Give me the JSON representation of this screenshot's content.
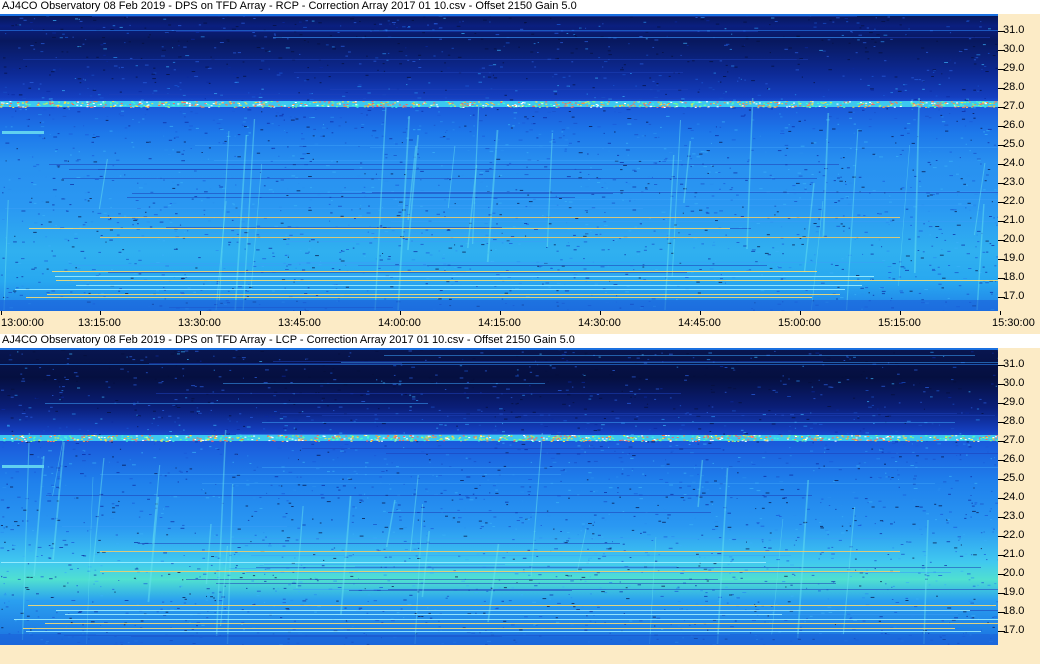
{
  "panels": [
    {
      "title": "AJ4CO Observatory 08 Feb 2019  -  DPS on TFD Array  -  RCP  -  Correction Array 2017 01 10.csv  -  Offset 2150  Gain 5.0",
      "y_ticks": [
        "31.0",
        "30.0",
        "29.0",
        "28.0",
        "27.0",
        "26.0",
        "25.0",
        "24.0",
        "23.0",
        "22.0",
        "21.0",
        "20.0",
        "19.0",
        "18.0",
        "17.0"
      ]
    },
    {
      "title": "AJ4CO Observatory 08 Feb 2019  -  DPS on TFD Array  -  LCP  -  Correction Array 2017 01 10.csv  -  Offset 2150  Gain 5.0",
      "y_ticks": [
        "31.0",
        "30.0",
        "29.0",
        "28.0",
        "27.0",
        "26.0",
        "25.0",
        "24.0",
        "23.0",
        "22.0",
        "21.0",
        "20.0",
        "19.0",
        "18.0",
        "17.0"
      ]
    }
  ],
  "x_ticks": [
    "13:00:00",
    "13:15:00",
    "13:30:00",
    "13:45:00",
    "14:00:00",
    "14:15:00",
    "14:30:00",
    "14:45:00",
    "15:00:00",
    "15:15:00",
    "15:30:00"
  ],
  "colors": {
    "background": "#fcebc6",
    "deep_blue": "#0a1a6e",
    "mid_blue": "#1560d8",
    "light_blue": "#2aa0f0",
    "cyan": "#40e0ff",
    "interference": "#ffe040"
  }
}
